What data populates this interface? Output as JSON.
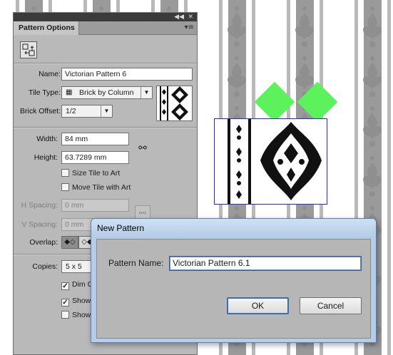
{
  "colors": {
    "panel_bg": "#b9b9b9",
    "dialog_frame": "#b5cde8",
    "tile_highlight": "#5bf25b",
    "tile_bounds": "#2a2acc"
  },
  "panel": {
    "title": "Pattern Options",
    "collapse_icon": "double-chevron-icon",
    "close_icon": "close-icon",
    "menu_icon": "panel-menu-icon",
    "tool_icon": "pattern-tile-tool-icon",
    "name_label": "Name:",
    "name_value": "Victorian Pattern 6",
    "tile_type_label": "Tile Type:",
    "tile_type_value": "Brick by Column",
    "brick_offset_label": "Brick Offset:",
    "brick_offset_value": "1/2",
    "width_label": "Width:",
    "width_value": "84 mm",
    "height_label": "Height:",
    "height_value": "63.7289 mm",
    "size_tile_label": "Size Tile to Art",
    "move_tile_label": "Move Tile with Art",
    "h_spacing_label": "H Spacing:",
    "h_spacing_value": "0 mm",
    "v_spacing_label": "V Spacing:",
    "v_spacing_value": "0 mm",
    "overlap_label": "Overlap:",
    "copies_label": "Copies:",
    "copies_value": "5 x 5",
    "dim_copies_label": "Dim C",
    "show_1_label": "Show",
    "show_2_label": "Show"
  },
  "dialog": {
    "title": "New Pattern",
    "pattern_name_label": "Pattern Name:",
    "pattern_name_value": "Victorian Pattern 6.1",
    "ok_label": "OK",
    "cancel_label": "Cancel"
  }
}
